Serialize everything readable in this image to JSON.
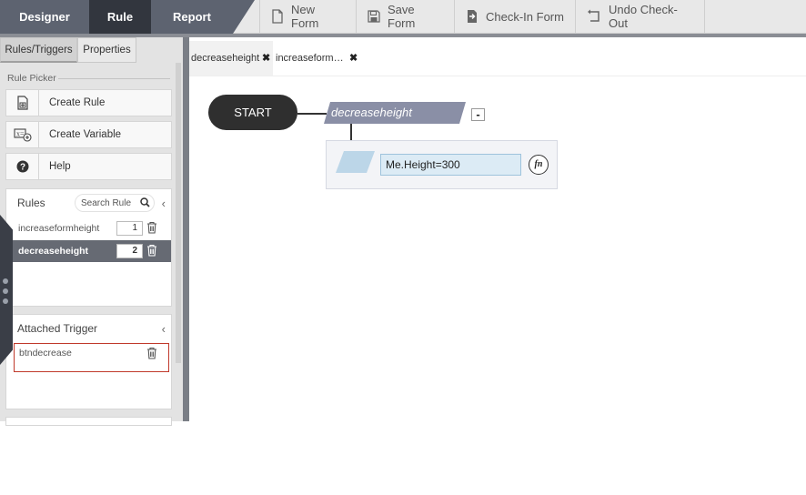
{
  "modes": {
    "designer": "Designer",
    "rule": "Rule",
    "report": "Report"
  },
  "toolbar": {
    "new_form": "New Form",
    "save_form": "Save Form",
    "check_in_form": "Check-In Form",
    "undo_check_out": "Undo Check-Out"
  },
  "left_tabs": {
    "rules_triggers": "Rules/Triggers",
    "properties": "Properties"
  },
  "rule_picker": {
    "title": "Rule Picker",
    "create_rule": "Create Rule",
    "create_variable": "Create Variable",
    "help": "Help"
  },
  "rules": {
    "title": "Rules",
    "search_placeholder": "Search Rule",
    "items": [
      {
        "name": "increaseformheight",
        "order": "1",
        "selected": false
      },
      {
        "name": "decreaseheight",
        "order": "2",
        "selected": true
      }
    ]
  },
  "attached_trigger": {
    "title": "Attached Trigger",
    "items": [
      {
        "name": "btndecrease"
      }
    ]
  },
  "doc_tabs": [
    {
      "label": "decreaseheight",
      "close": "✖"
    },
    {
      "label": "increaseform…",
      "close": "✖"
    }
  ],
  "canvas": {
    "start_label": "START",
    "rule_name": "decreaseheight",
    "collapse_label": "-",
    "action_expression": "Me.Height=300",
    "fn_label": "fn"
  },
  "icons": {
    "new_form": "document-icon",
    "save_form": "floppy-disk-icon",
    "check_in_form": "check-in-icon",
    "undo_check_out": "undo-icon",
    "search": "search-icon",
    "delete": "trash-icon",
    "help": "question-circle-icon",
    "collapse_panel": "chevron-left-icon"
  },
  "colors": {
    "active_mode": "#32363e",
    "mode_bar": "#5d6370",
    "rule_node": "#8a8fa6",
    "action_shape": "#bcd6e8",
    "trigger_highlight": "#c0392b",
    "selected_row": "#666a73"
  }
}
